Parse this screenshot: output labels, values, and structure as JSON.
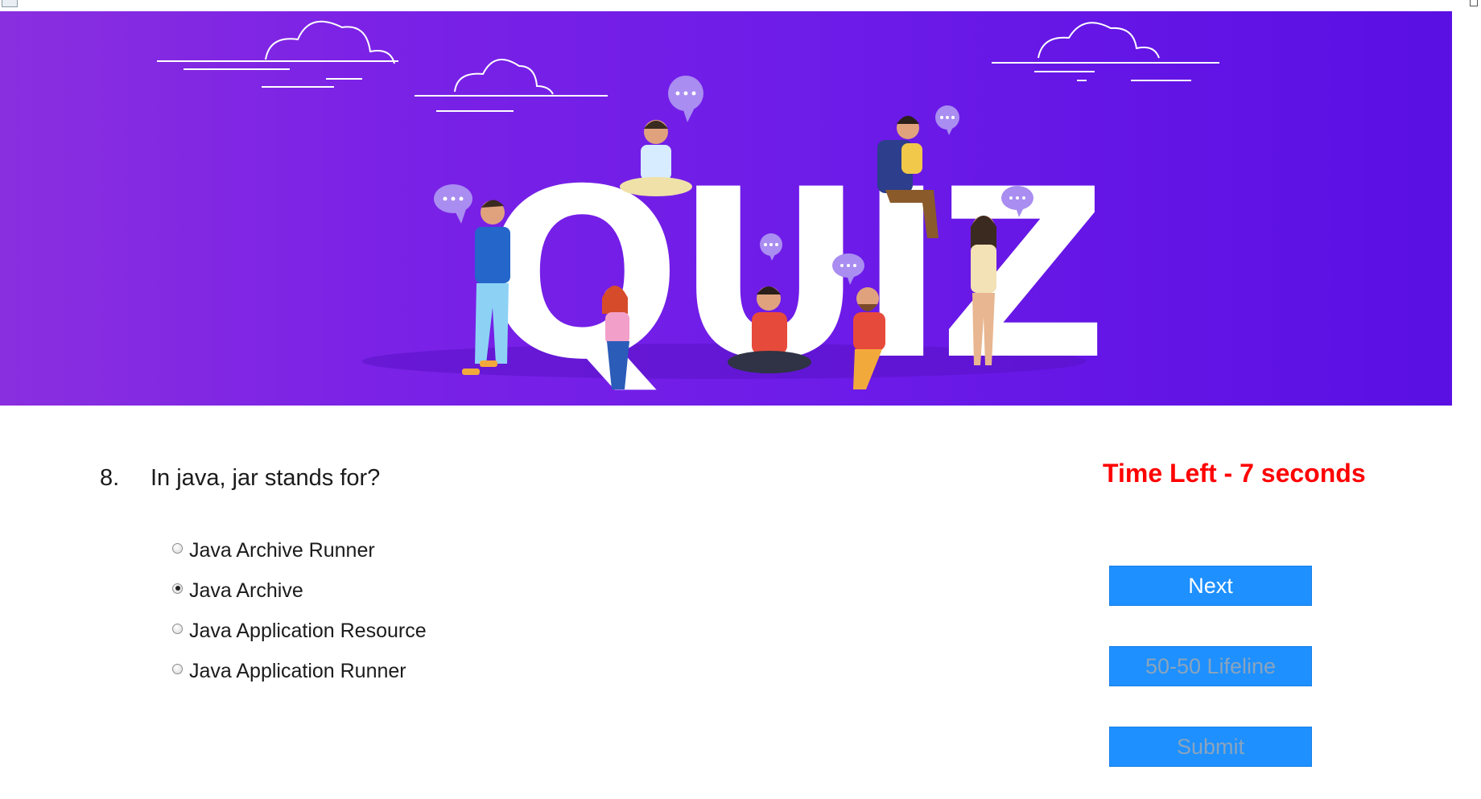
{
  "banner": {
    "title": "QUIZ"
  },
  "question": {
    "number": "8.",
    "text": "In java, jar stands for?"
  },
  "timer": {
    "text": "Time Left - 7 seconds",
    "color": "#ff0000"
  },
  "options": [
    {
      "label": "Java Archive Runner",
      "selected": false
    },
    {
      "label": "Java Archive",
      "selected": true
    },
    {
      "label": "Java Application Resource",
      "selected": false
    },
    {
      "label": "Java Application Runner",
      "selected": false
    }
  ],
  "buttons": {
    "next": "Next",
    "lifeline": "50-50 Lifeline",
    "submit": "Submit"
  },
  "colors": {
    "accent": "#1e90ff",
    "banner_start": "#8a2fdf",
    "banner_end": "#5a0fe3"
  }
}
